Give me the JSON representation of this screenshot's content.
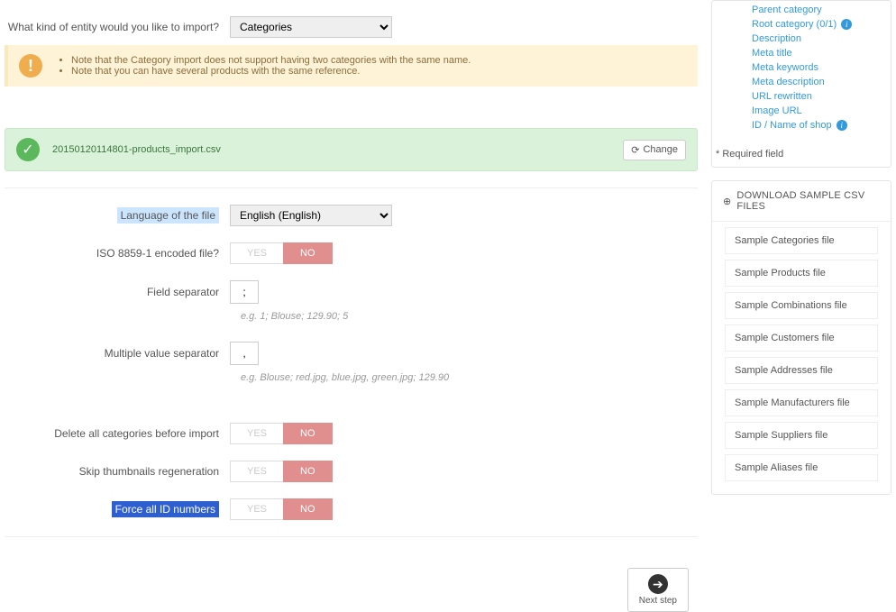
{
  "form": {
    "entity_label": "What kind of entity would you like to import?",
    "entity_value": "Categories",
    "language_label": "Language of the file",
    "language_value": "English (English)",
    "iso_label": "ISO 8859-1 encoded file?",
    "field_sep_label": "Field separator",
    "field_sep_value": ";",
    "field_sep_hint": "e.g. 1; Blouse; 129.90; 5",
    "multi_sep_label": "Multiple value separator",
    "multi_sep_value": ",",
    "multi_sep_hint": "e.g. Blouse; red.jpg, blue.jpg, green.jpg; 129.90",
    "delete_label": "Delete all categories before import",
    "skip_label": "Skip thumbnails regeneration",
    "force_id_label": "Force all ID numbers",
    "yes": "YES",
    "no": "NO"
  },
  "alerts": {
    "note1": "Note that the Category import does not support having two categories with the same name.",
    "note2": "Note that you can have several products with the same reference.",
    "filename": "20150120114801-products_import.csv",
    "change": "Change"
  },
  "next_step": "Next step",
  "side_fields": {
    "items": [
      "Parent category",
      "Root category (0/1)",
      "Description",
      "Meta title",
      "Meta keywords",
      "Meta description",
      "URL rewritten",
      "Image URL",
      "ID / Name of shop"
    ],
    "info_indices": [
      1,
      8
    ],
    "required_note": "* Required field"
  },
  "download_panel": {
    "title": "DOWNLOAD SAMPLE CSV FILES",
    "items": [
      "Sample Categories file",
      "Sample Products file",
      "Sample Combinations file",
      "Sample Customers file",
      "Sample Addresses file",
      "Sample Manufacturers file",
      "Sample Suppliers file",
      "Sample Aliases file"
    ]
  }
}
